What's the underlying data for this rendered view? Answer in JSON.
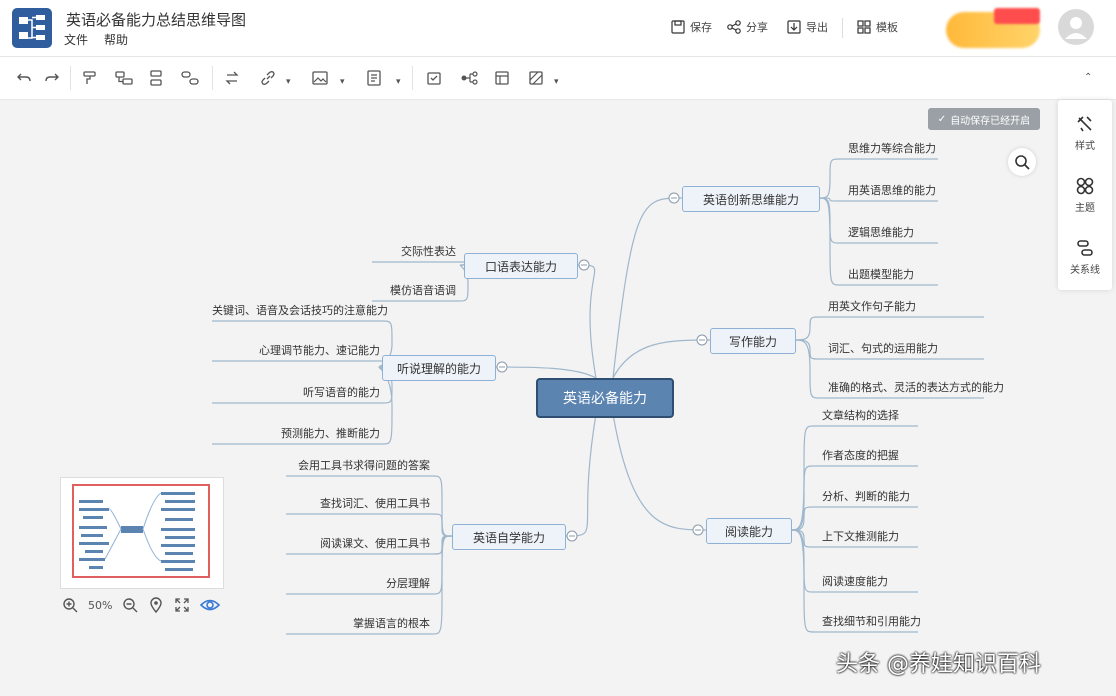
{
  "app": {
    "title": "英语必备能力总结思维导图",
    "menu": [
      "文件",
      "帮助"
    ]
  },
  "header_actions": [
    {
      "label": "保存",
      "icon": "save-icon"
    },
    {
      "label": "分享",
      "icon": "share-icon"
    },
    {
      "label": "导出",
      "icon": "export-icon"
    },
    {
      "label": "模板",
      "icon": "template-icon"
    }
  ],
  "autosave_label": "自动保存已经开启",
  "right_panel": [
    {
      "label": "样式",
      "icon": "style-icon"
    },
    {
      "label": "主题",
      "icon": "theme-icon"
    },
    {
      "label": "关系线",
      "icon": "relation-line-icon"
    }
  ],
  "zoom": "50%",
  "watermark": "头条 @养娃知识百科",
  "colors": {
    "center": "#5b84b1",
    "branch": "#8fb1d5",
    "line": "#9fb7cc",
    "accent": "#2f5d9e"
  },
  "mindmap": {
    "center": "英语必备能力",
    "branches": [
      {
        "label": "英语创新思维能力",
        "children": [
          "思维力等综合能力",
          "用英语思维的能力",
          "逻辑思维能力",
          "出题模型能力"
        ]
      },
      {
        "label": "写作能力",
        "children": [
          "用英文作句子能力",
          "词汇、句式的运用能力",
          "准确的格式、灵活的表达方式的能力"
        ]
      },
      {
        "label": "阅读能力",
        "children": [
          "文章结构的选择",
          "作者态度的把握",
          "分析、判断的能力",
          "上下文推测能力",
          "阅读速度能力",
          "查找细节和引用能力"
        ]
      },
      {
        "label": "口语表达能力",
        "children": [
          "交际性表达",
          "模仿语音语调"
        ]
      },
      {
        "label": "听说理解的能力",
        "children": [
          "关键词、语音及会话技巧的注意能力",
          "心理调节能力、速记能力",
          "听写语音的能力",
          "预测能力、推断能力"
        ]
      },
      {
        "label": "英语自学能力",
        "children": [
          "会用工具书求得问题的答案",
          "查找词汇、使用工具书",
          "阅读课文、使用工具书",
          "分层理解",
          "掌握语言的根本"
        ]
      }
    ]
  }
}
